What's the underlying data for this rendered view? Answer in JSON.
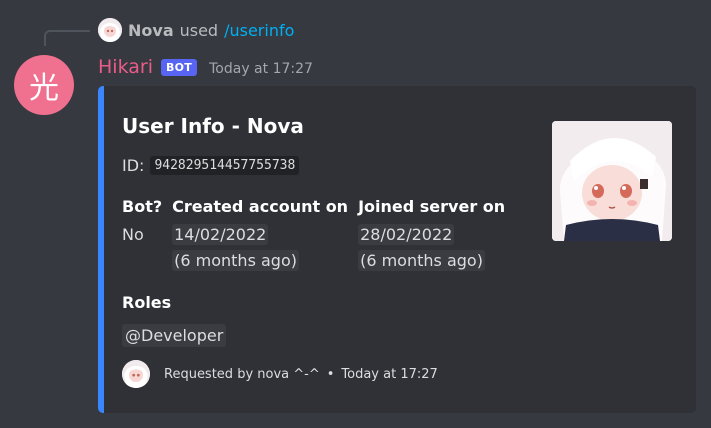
{
  "reply": {
    "user": "Nova",
    "used_text": "used",
    "command": "/userinfo"
  },
  "message": {
    "avatar_glyph": "光",
    "author": "Hikari",
    "bot_badge": "BOT",
    "timestamp": "Today at 17:27"
  },
  "embed": {
    "accent_color": "#3a86ff",
    "title": "User Info - Nova",
    "id_label": "ID:",
    "id_value": "942829514457755738",
    "fields": [
      {
        "name": "Bot?",
        "value_line1": "No",
        "value_line2": ""
      },
      {
        "name": "Created account on",
        "value_line1": "14/02/2022",
        "value_line2": "(6 months ago)"
      },
      {
        "name": "Joined server on",
        "value_line1": "28/02/2022",
        "value_line2": "(6 months ago)"
      }
    ],
    "roles_name": "Roles",
    "roles_value": "@Developer",
    "footer_text": "Requested by nova ^-^",
    "footer_sep": "•",
    "footer_time": "Today at 17:27"
  },
  "colors": {
    "background": "#36393f",
    "embed_bg": "#2f3136",
    "author": "#ea5c87",
    "bot_badge": "#5865f2",
    "link": "#00aff4"
  }
}
